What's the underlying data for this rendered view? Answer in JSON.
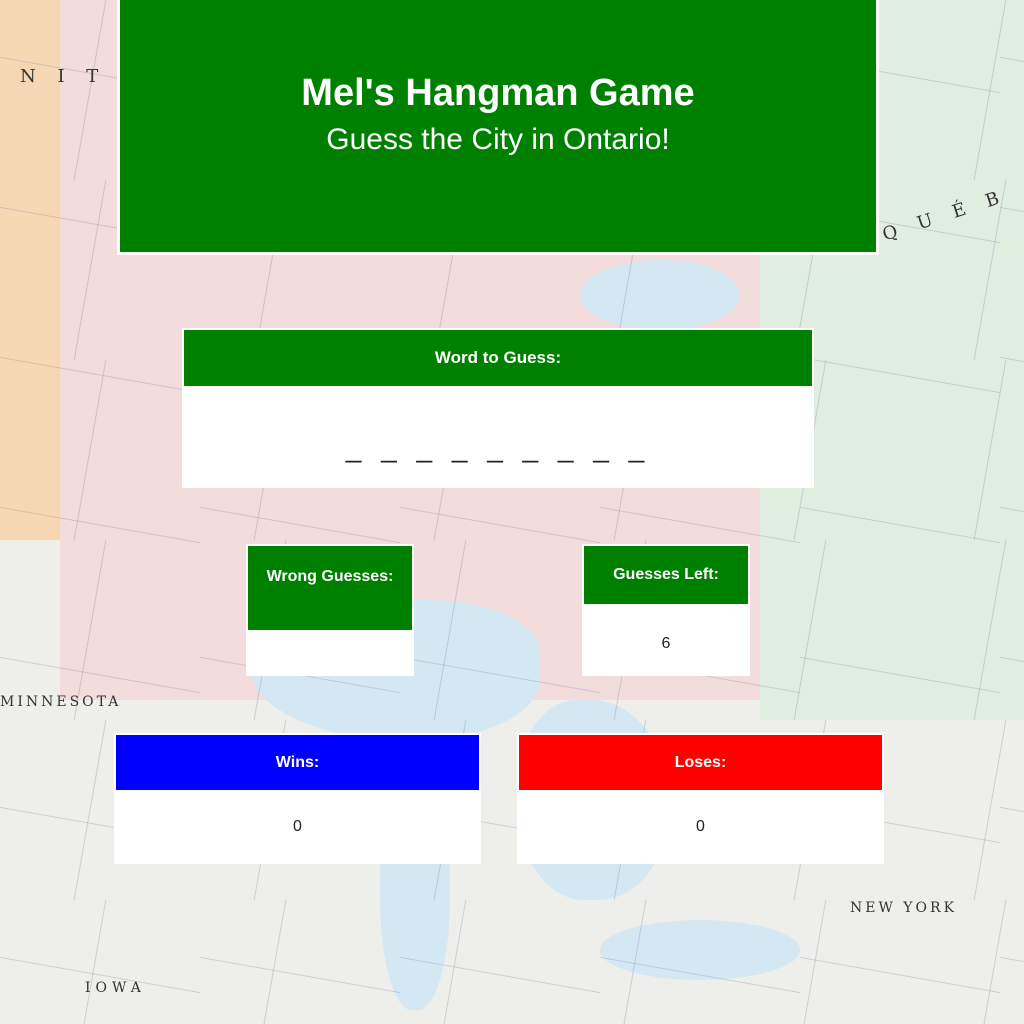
{
  "background": {
    "labels": {
      "manitoba": "N I T O",
      "quebec": "Q U É B",
      "minnesota": "MINNESOTA",
      "new_york": "NEW YORK",
      "iowa": "IOWA"
    }
  },
  "header": {
    "title": "Mel's Hangman Game",
    "subtitle": "Guess the City in Ontario!",
    "color": "#008000"
  },
  "word_panel": {
    "label": "Word to Guess:",
    "value": "_ _ _ _ _ _ _ _ _",
    "color": "#008000"
  },
  "wrong_guesses_panel": {
    "label": "Wrong Guesses:",
    "value": "",
    "color": "#008000"
  },
  "guesses_left_panel": {
    "label": "Guesses Left:",
    "value": "6",
    "color": "#008000"
  },
  "wins_panel": {
    "label": "Wins:",
    "value": "0",
    "color": "#0000ff"
  },
  "loses_panel": {
    "label": "Loses:",
    "value": "0",
    "color": "#ff0000"
  }
}
